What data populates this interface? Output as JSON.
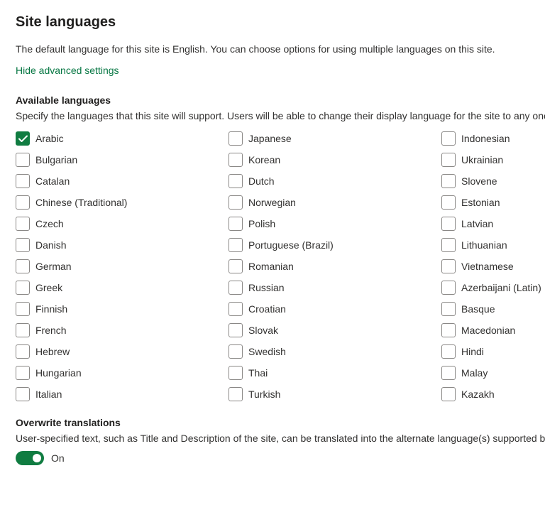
{
  "title": "Site languages",
  "description": "The default language for this site is English. You can choose options for using multiple languages on this site.",
  "advanced_link": "Hide advanced settings",
  "available": {
    "title": "Available languages",
    "description": "Specify the languages that this site will support. Users will be able to change their display language for the site to any one",
    "columns": [
      [
        {
          "label": "Arabic",
          "checked": true
        },
        {
          "label": "Bulgarian",
          "checked": false
        },
        {
          "label": "Catalan",
          "checked": false
        },
        {
          "label": "Chinese (Traditional)",
          "checked": false
        },
        {
          "label": "Czech",
          "checked": false
        },
        {
          "label": "Danish",
          "checked": false
        },
        {
          "label": "German",
          "checked": false
        },
        {
          "label": "Greek",
          "checked": false
        },
        {
          "label": "Finnish",
          "checked": false
        },
        {
          "label": "French",
          "checked": false
        },
        {
          "label": "Hebrew",
          "checked": false
        },
        {
          "label": "Hungarian",
          "checked": false
        },
        {
          "label": "Italian",
          "checked": false
        }
      ],
      [
        {
          "label": "Japanese",
          "checked": false
        },
        {
          "label": "Korean",
          "checked": false
        },
        {
          "label": "Dutch",
          "checked": false
        },
        {
          "label": "Norwegian",
          "checked": false
        },
        {
          "label": "Polish",
          "checked": false
        },
        {
          "label": "Portuguese (Brazil)",
          "checked": false
        },
        {
          "label": "Romanian",
          "checked": false
        },
        {
          "label": "Russian",
          "checked": false
        },
        {
          "label": "Croatian",
          "checked": false
        },
        {
          "label": "Slovak",
          "checked": false
        },
        {
          "label": "Swedish",
          "checked": false
        },
        {
          "label": "Thai",
          "checked": false
        },
        {
          "label": "Turkish",
          "checked": false
        }
      ],
      [
        {
          "label": "Indonesian",
          "checked": false
        },
        {
          "label": "Ukrainian",
          "checked": false
        },
        {
          "label": "Slovene",
          "checked": false
        },
        {
          "label": "Estonian",
          "checked": false
        },
        {
          "label": "Latvian",
          "checked": false
        },
        {
          "label": "Lithuanian",
          "checked": false
        },
        {
          "label": "Vietnamese",
          "checked": false
        },
        {
          "label": "Azerbaijani (Latin)",
          "checked": false
        },
        {
          "label": "Basque",
          "checked": false
        },
        {
          "label": "Macedonian",
          "checked": false
        },
        {
          "label": "Hindi",
          "checked": false
        },
        {
          "label": "Malay",
          "checked": false
        },
        {
          "label": "Kazakh",
          "checked": false
        }
      ]
    ]
  },
  "overwrite": {
    "title": "Overwrite translations",
    "description": "User-specified text, such as Title and Description of the site, can be translated into the alternate language(s) supported by default language should automatically overwrite the existing translations made in all alternate languages. This setting do",
    "toggle_on": true,
    "toggle_label": "On"
  }
}
